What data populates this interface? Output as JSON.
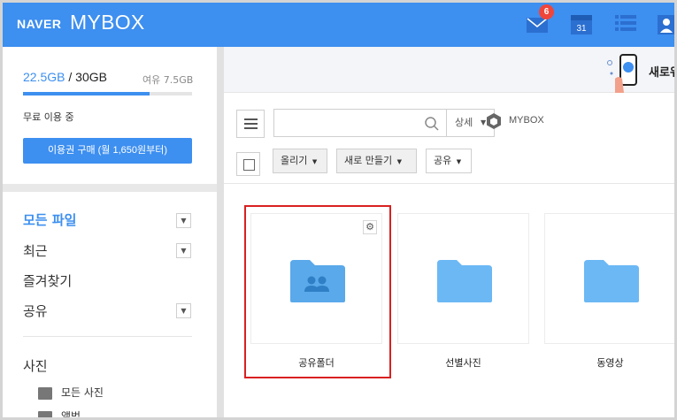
{
  "header": {
    "brand": "NAVER",
    "app_name": "MYBOX",
    "mail_badge": "6",
    "calendar_day": "31",
    "accent_color": "#3d8ff0"
  },
  "sidebar": {
    "storage_used": "22.5GB",
    "storage_sep": " / ",
    "storage_total": "30GB",
    "storage_free": "여유 7.5GB",
    "storage_fill_fraction": 0.75,
    "plan_status": "무료 이용 중",
    "buy_button": "이용권 구매 (월 1,650원부터)",
    "nav": [
      {
        "label": "모든 파일",
        "active": true,
        "has_caret": true
      },
      {
        "label": "최근",
        "active": false,
        "has_caret": true
      },
      {
        "label": "즐겨찾기",
        "active": false,
        "has_caret": false
      },
      {
        "label": "공유",
        "active": false,
        "has_caret": true
      }
    ],
    "photos_heading": "사진",
    "photo_items": [
      {
        "label": "모든 사진",
        "icon": "image-icon"
      },
      {
        "label": "앨범",
        "icon": "album-icon"
      }
    ]
  },
  "banner": {
    "text": "새로워"
  },
  "toolbar": {
    "search_placeholder": "",
    "detail_label": "상세",
    "breadcrumb": "MYBOX",
    "upload_label": "올리기",
    "new_label": "새로 만들기",
    "share_label": "공유"
  },
  "files": [
    {
      "name": "공유폴더",
      "type": "shared-folder",
      "selected": true
    },
    {
      "name": "선별사진",
      "type": "folder",
      "selected": false
    },
    {
      "name": "동영상",
      "type": "folder",
      "selected": false
    }
  ]
}
